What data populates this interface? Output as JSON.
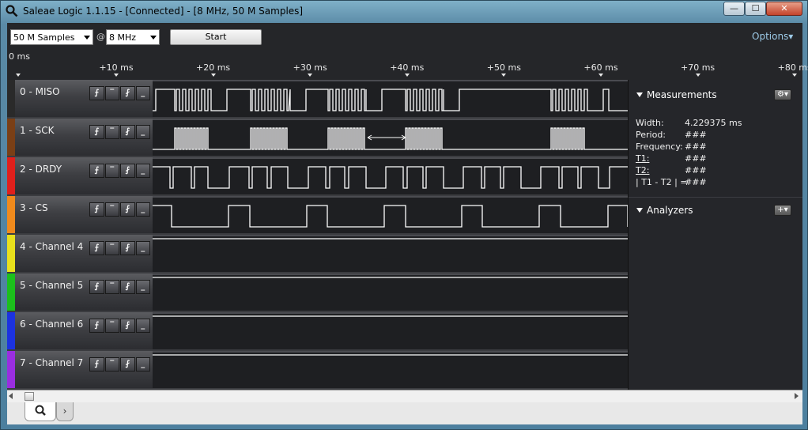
{
  "window": {
    "title": "Saleae Logic 1.1.15 - [Connected] - [8 MHz, 50 M Samples]",
    "minimize": "—",
    "maximize": "☐",
    "close": "✕"
  },
  "toolbar": {
    "samples_value": "50 M Samples",
    "at": "@",
    "rate_value": "8 MHz",
    "start_label": "Start",
    "options_label": "Options▾"
  },
  "timeline": {
    "zero_label": "0 ms",
    "ticks": [
      "+10 ms",
      "+20 ms",
      "+30 ms",
      "+40 ms",
      "+50 ms",
      "+60 ms",
      "+70 ms",
      "+80 ms"
    ]
  },
  "channels": [
    {
      "name": "0 - MISO",
      "color": "#2a2a2a"
    },
    {
      "name": "1 - SCK",
      "color": "#7a3f16"
    },
    {
      "name": "2 - DRDY",
      "color": "#e0201c"
    },
    {
      "name": "3 - CS",
      "color": "#f08a1c"
    },
    {
      "name": "4 - Channel 4",
      "color": "#e8e01c"
    },
    {
      "name": "5 - Channel 5",
      "color": "#1cc01c"
    },
    {
      "name": "6 - Channel 6",
      "color": "#1c32e0"
    },
    {
      "name": "7 - Channel 7",
      "color": "#9a2ee0"
    }
  ],
  "trigger_buttons": [
    "⨍",
    "‾",
    "⨏",
    "_"
  ],
  "measurements": {
    "title": "Measurements",
    "rows": [
      {
        "label": "Width:",
        "value": "4.229375 ms"
      },
      {
        "label": "Period:",
        "value": "###"
      },
      {
        "label": "Frequency:",
        "value": "###"
      },
      {
        "label": "T1:",
        "value": "###"
      },
      {
        "label": "T2:",
        "value": "###"
      },
      {
        "label": "| T1 - T2 | =",
        "value": "###"
      }
    ],
    "gear": "⚙▾"
  },
  "analyzers": {
    "title": "Analyzers",
    "add": "+▾"
  },
  "colors": {
    "background": "#252629",
    "wave": "#ffffff",
    "accent": "#9cc9e6"
  }
}
